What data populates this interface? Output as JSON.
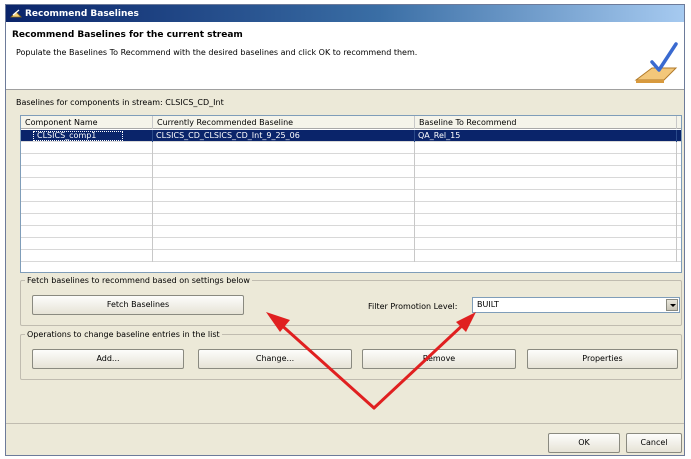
{
  "window": {
    "title": "Recommend Baselines"
  },
  "header": {
    "title": "Recommend Baselines for the current stream",
    "description": "Populate the Baselines To Recommend with the desired baselines and click OK to recommend them."
  },
  "components_table": {
    "label": "Baselines for components in stream:  CLSICS_CD_Int",
    "columns": [
      "Component Name",
      "Currently Recommended Baseline",
      "Baseline To Recommend"
    ],
    "rows": [
      [
        "CLSICS_comp1",
        "CLSICS_CD_CLSICS_CD_Int_9_25_06",
        "QA_Rel_15"
      ]
    ]
  },
  "fetch_group": {
    "legend": "Fetch baselines to recommend based on settings below",
    "fetch_button": "Fetch Baselines",
    "filter_label": "Filter Promotion Level:",
    "filter_value": "BUILT"
  },
  "ops_group": {
    "legend": "Operations to change baseline entries in the list",
    "add_button": "Add...",
    "change_button": "Change...",
    "remove_button": "Remove",
    "properties_button": "Properties"
  },
  "footer": {
    "ok_button": "OK",
    "cancel_button": "Cancel"
  },
  "annotation": {
    "arrow_color": "#e02020"
  }
}
